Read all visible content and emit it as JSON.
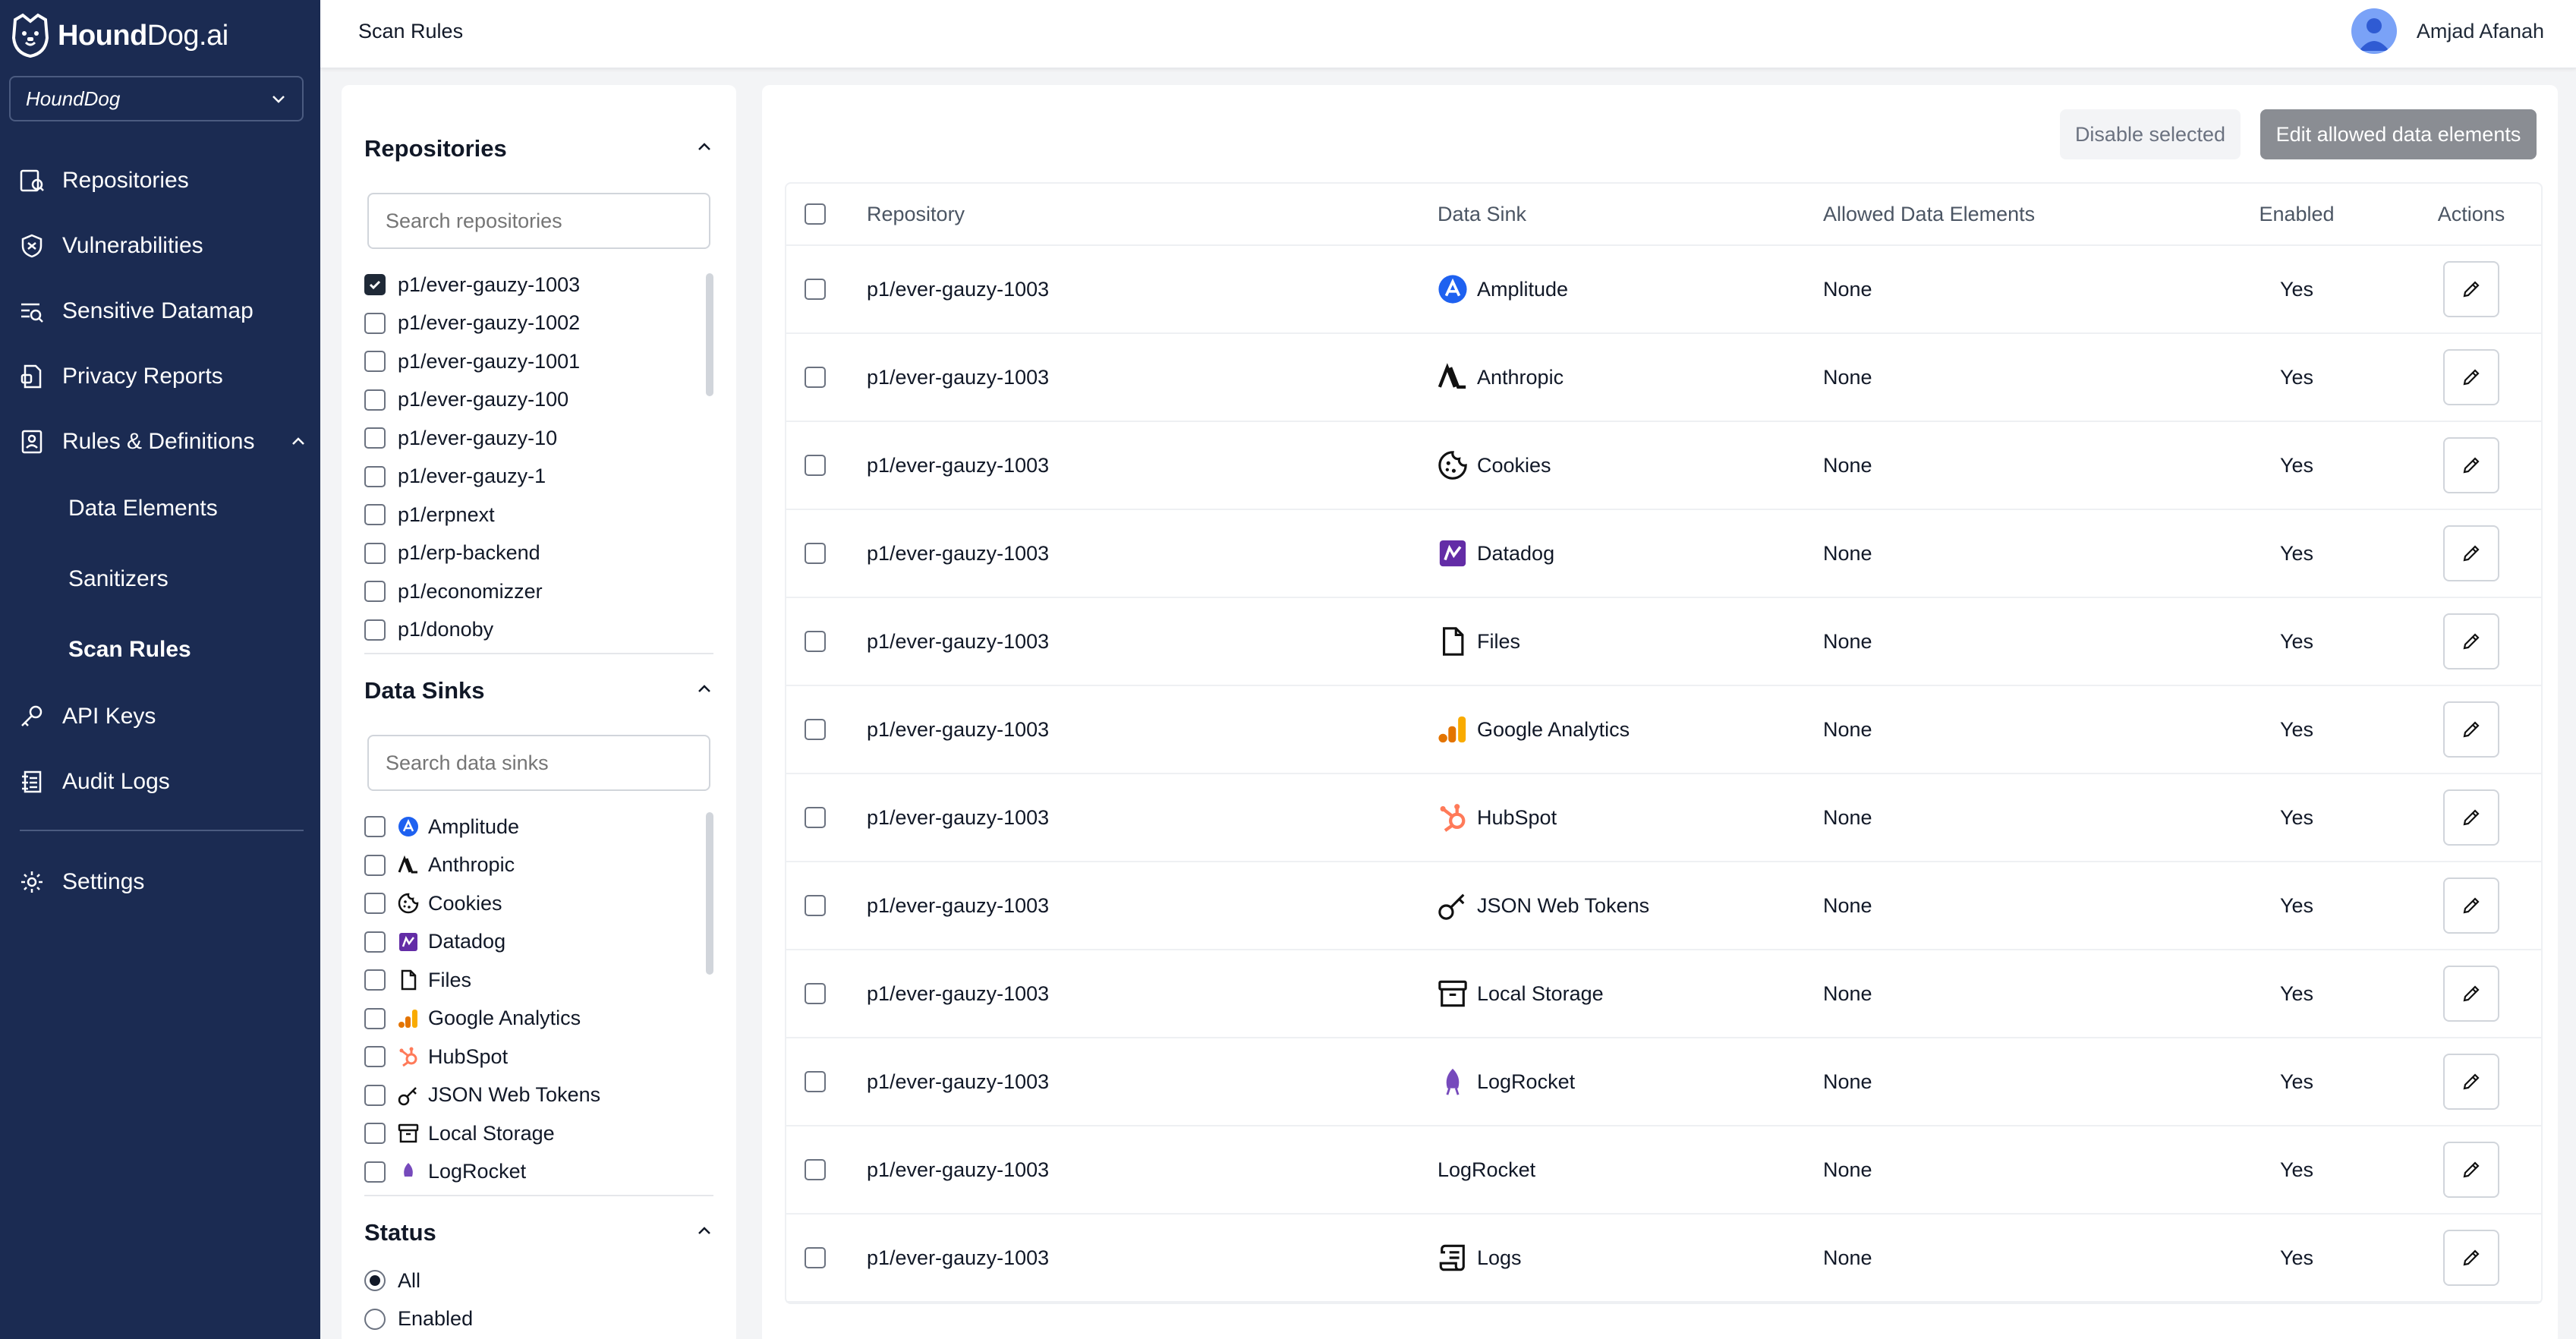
{
  "brand": {
    "bold": "Hound",
    "light": "Dog.ai"
  },
  "org": {
    "selected": "HoundDog"
  },
  "nav": {
    "repositories": "Repositories",
    "vulnerabilities": "Vulnerabilities",
    "sensitive_datamap": "Sensitive Datamap",
    "privacy_reports": "Privacy Reports",
    "rules": "Rules & Definitions",
    "data_elements": "Data Elements",
    "sanitizers": "Sanitizers",
    "scan_rules": "Scan Rules",
    "api_keys": "API Keys",
    "audit_logs": "Audit Logs",
    "settings": "Settings"
  },
  "topbar": {
    "title": "Scan Rules",
    "user": "Amjad Afanah"
  },
  "filters": {
    "repositories": {
      "title": "Repositories",
      "placeholder": "Search repositories",
      "items": [
        {
          "label": "p1/ever-gauzy-1003",
          "checked": true
        },
        {
          "label": "p1/ever-gauzy-1002",
          "checked": false
        },
        {
          "label": "p1/ever-gauzy-1001",
          "checked": false
        },
        {
          "label": "p1/ever-gauzy-100",
          "checked": false
        },
        {
          "label": "p1/ever-gauzy-10",
          "checked": false
        },
        {
          "label": "p1/ever-gauzy-1",
          "checked": false
        },
        {
          "label": "p1/erpnext",
          "checked": false
        },
        {
          "label": "p1/erp-backend",
          "checked": false
        },
        {
          "label": "p1/economizzer",
          "checked": false
        },
        {
          "label": "p1/donoby",
          "checked": false
        }
      ]
    },
    "sinks": {
      "title": "Data Sinks",
      "placeholder": "Search data sinks",
      "items": [
        "Amplitude",
        "Anthropic",
        "Cookies",
        "Datadog",
        "Files",
        "Google Analytics",
        "HubSpot",
        "JSON Web Tokens",
        "Local Storage",
        "LogRocket"
      ]
    },
    "status": {
      "title": "Status",
      "options": [
        {
          "label": "All",
          "selected": true
        },
        {
          "label": "Enabled",
          "selected": false
        }
      ]
    }
  },
  "actions": {
    "disable": "Disable selected",
    "edit": "Edit allowed data elements"
  },
  "table": {
    "headers": {
      "repository": "Repository",
      "sink": "Data Sink",
      "allowed": "Allowed Data Elements",
      "enabled": "Enabled",
      "actions": "Actions"
    },
    "rows": [
      {
        "repo": "p1/ever-gauzy-1003",
        "sink": "Amplitude",
        "icon": "amplitude-icon",
        "allowed": "None",
        "enabled": "Yes"
      },
      {
        "repo": "p1/ever-gauzy-1003",
        "sink": "Anthropic",
        "icon": "anthropic-icon",
        "allowed": "None",
        "enabled": "Yes"
      },
      {
        "repo": "p1/ever-gauzy-1003",
        "sink": "Cookies",
        "icon": "cookie-icon",
        "allowed": "None",
        "enabled": "Yes"
      },
      {
        "repo": "p1/ever-gauzy-1003",
        "sink": "Datadog",
        "icon": "datadog-icon",
        "allowed": "None",
        "enabled": "Yes"
      },
      {
        "repo": "p1/ever-gauzy-1003",
        "sink": "Files",
        "icon": "file-icon",
        "allowed": "None",
        "enabled": "Yes"
      },
      {
        "repo": "p1/ever-gauzy-1003",
        "sink": "Google Analytics",
        "icon": "google-analytics-icon",
        "allowed": "None",
        "enabled": "Yes"
      },
      {
        "repo": "p1/ever-gauzy-1003",
        "sink": "HubSpot",
        "icon": "hubspot-icon",
        "allowed": "None",
        "enabled": "Yes"
      },
      {
        "repo": "p1/ever-gauzy-1003",
        "sink": "JSON Web Tokens",
        "icon": "key-icon",
        "allowed": "None",
        "enabled": "Yes"
      },
      {
        "repo": "p1/ever-gauzy-1003",
        "sink": "Local Storage",
        "icon": "archive-icon",
        "allowed": "None",
        "enabled": "Yes"
      },
      {
        "repo": "p1/ever-gauzy-1003",
        "sink": "LogRocket",
        "icon": "logrocket-icon",
        "allowed": "None",
        "enabled": "Yes"
      },
      {
        "repo": "p1/ever-gauzy-1003",
        "sink": "LogRocket",
        "icon": "",
        "allowed": "None",
        "enabled": "Yes"
      },
      {
        "repo": "p1/ever-gauzy-1003",
        "sink": "Logs",
        "icon": "scroll-icon",
        "allowed": "None",
        "enabled": "Yes"
      }
    ]
  },
  "colors": {
    "sidebar": "#1b2b52",
    "accent": "#3b6fe0",
    "edit_button": "#8a8d93"
  }
}
